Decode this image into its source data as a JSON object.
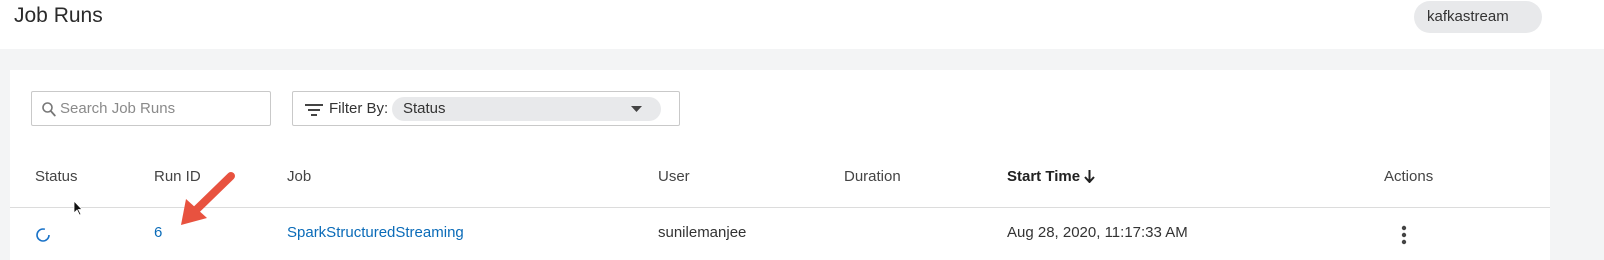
{
  "header": {
    "title": "Job Runs",
    "environment": "kafkastream"
  },
  "toolbar": {
    "search_placeholder": "Search Job Runs",
    "filter_label": "Filter By:",
    "filter_value": "Status"
  },
  "table": {
    "columns": {
      "status": "Status",
      "run_id": "Run ID",
      "job": "Job",
      "user": "User",
      "duration": "Duration",
      "start_time": "Start Time",
      "actions": "Actions"
    },
    "sort_column": "start_time",
    "sort_direction": "descending",
    "rows": [
      {
        "status_icon": "running-spinner-icon",
        "run_id": "6",
        "job": "SparkStructuredStreaming",
        "user": "sunilemanjee",
        "duration": "",
        "start_time": "Aug 28, 2020, 11:17:33 AM",
        "actions_icon": "kebab-menu-icon"
      }
    ]
  },
  "colors": {
    "link": "#0a6bb8",
    "annotation_arrow": "#e8523f",
    "spinner": "#1a73c8",
    "page_background": "#f3f4f5"
  }
}
